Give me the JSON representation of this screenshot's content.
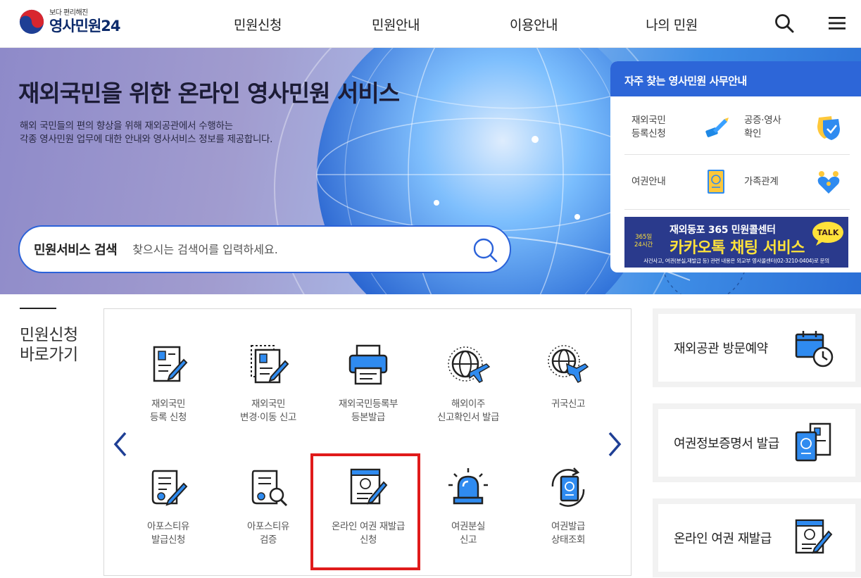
{
  "header": {
    "logo_tagline": "보다 편리해진",
    "logo_name": "영사민원24",
    "nav": [
      "민원신청",
      "민원안내",
      "이용안내",
      "나의 민원"
    ]
  },
  "hero": {
    "title": "재외국민을 위한 온라인 영사민원 서비스",
    "desc_line1": "해외 국민들의 편의 향상을 위해 재외공관에서 수행하는",
    "desc_line2": "각종 영사민원 업무에 대한 안내와 영사서비스 정보를 제공합니다.",
    "search": {
      "label": "민원서비스 검색",
      "placeholder": "찾으시는 검색어를 입력하세요."
    }
  },
  "panel": {
    "title": "자주 찾는 영사민원 사무안내",
    "items": [
      {
        "label": "재외국민\n등록신청",
        "icon": "registration-icon"
      },
      {
        "label": "공증·영사\n확인",
        "icon": "shield-check-icon"
      },
      {
        "label": "여권안내",
        "icon": "passport-icon"
      },
      {
        "label": "가족관계",
        "icon": "family-heart-icon"
      }
    ],
    "banner": {
      "top": "재외동포 365 민원콜센터",
      "main": "카카오톡 채팅 서비스",
      "badge_line1": "365일",
      "badge_line2": "24시간",
      "talk": "TALK",
      "sub": "사건사고, 여권(분실,재발급 등) 관련 내용은 외교부 영사콜센터(02-3210-0404)로 문의"
    }
  },
  "quick": {
    "title_line1": "민원신청",
    "title_line2": "바로가기",
    "items": [
      {
        "label": "재외국민\n등록 신청",
        "icon": "registration-form-icon"
      },
      {
        "label": "재외국민\n변경·이동 신고",
        "icon": "change-report-icon"
      },
      {
        "label": "재외국민등록부\n등본발급",
        "icon": "printer-icon"
      },
      {
        "label": "해외이주\n신고확인서 발급",
        "icon": "globe-plane-icon"
      },
      {
        "label": "귀국신고",
        "icon": "return-plane-icon"
      },
      {
        "label": "아포스티유\n발급신청",
        "icon": "apostille-scroll-icon"
      },
      {
        "label": "아포스티유\n검증",
        "icon": "apostille-verify-icon"
      },
      {
        "label": "온라인 여권 재발급\n신청",
        "icon": "online-passport-icon"
      },
      {
        "label": "여권분실\n신고",
        "icon": "siren-icon"
      },
      {
        "label": "여권발급\n상태조회",
        "icon": "passport-status-icon"
      }
    ]
  },
  "cards": [
    {
      "label": "재외공관 방문예약",
      "icon": "calendar-clock-icon"
    },
    {
      "label": "여권정보증명서 발급",
      "icon": "passport-certificate-icon"
    },
    {
      "label": "온라인 여권 재발급",
      "icon": "online-passport-card-icon"
    }
  ],
  "colors": {
    "brand_blue": "#2d66d8",
    "highlight_red": "#e01b1b",
    "banner_yellow": "#ffe23a"
  }
}
